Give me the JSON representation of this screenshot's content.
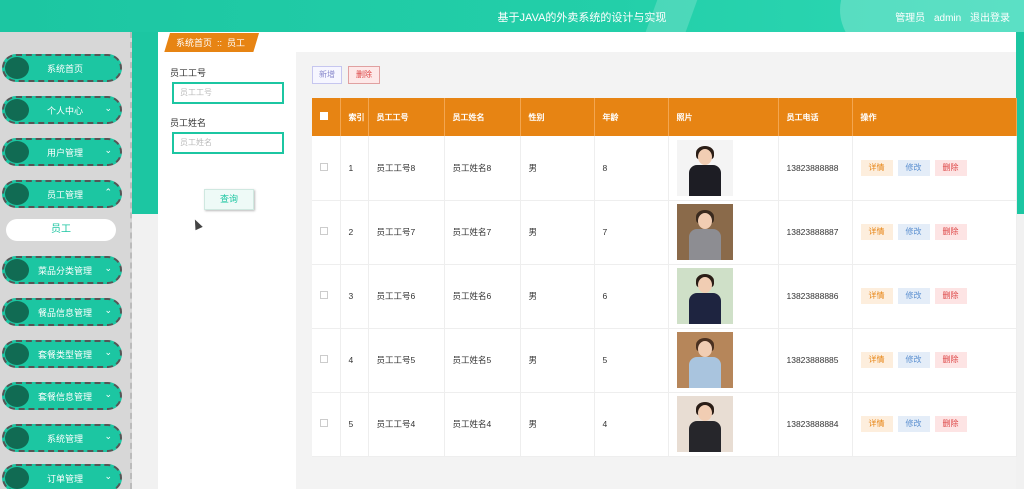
{
  "header": {
    "title": "基于JAVA的外卖系统的设计与实现",
    "role": "管理员",
    "username": "admin",
    "logout": "退出登录"
  },
  "sidebar": {
    "items": [
      {
        "label": "系统首页"
      },
      {
        "label": "个人中心"
      },
      {
        "label": "用户管理"
      },
      {
        "label": "员工管理"
      },
      {
        "label": "菜品分类管理"
      },
      {
        "label": "餐品信息管理"
      },
      {
        "label": "套餐类型管理"
      },
      {
        "label": "套餐信息管理"
      },
      {
        "label": "系统管理"
      },
      {
        "label": "订单管理"
      }
    ],
    "submenu_active": "员工"
  },
  "breadcrumb": {
    "home": "系统首页",
    "separator": "::",
    "current": "员工"
  },
  "search": {
    "emp_no_label": "员工工号",
    "emp_no_placeholder": "员工工号",
    "emp_name_label": "员工姓名",
    "emp_name_placeholder": "员工姓名",
    "query_button": "查询"
  },
  "toolbar": {
    "new_label": "新增",
    "delete_label": "删除"
  },
  "table": {
    "columns": [
      "索引",
      "员工工号",
      "员工姓名",
      "性别",
      "年龄",
      "照片",
      "员工电话",
      "操作"
    ],
    "actions": {
      "detail": "详情",
      "edit": "修改",
      "delete": "删除"
    },
    "rows": [
      {
        "index": "1",
        "emp_no": "员工工号8",
        "name": "员工姓名8",
        "gender": "男",
        "age": "8",
        "phone": "13823888888"
      },
      {
        "index": "2",
        "emp_no": "员工工号7",
        "name": "员工姓名7",
        "gender": "男",
        "age": "7",
        "phone": "13823888887"
      },
      {
        "index": "3",
        "emp_no": "员工工号6",
        "name": "员工姓名6",
        "gender": "男",
        "age": "6",
        "phone": "13823888886"
      },
      {
        "index": "4",
        "emp_no": "员工工号5",
        "name": "员工姓名5",
        "gender": "男",
        "age": "5",
        "phone": "13823888885"
      },
      {
        "index": "5",
        "emp_no": "员工工号4",
        "name": "员工姓名4",
        "gender": "男",
        "age": "4",
        "phone": "13823888884"
      }
    ]
  },
  "colors": {
    "primary": "#1cc6a2",
    "header_orange": "#e78413",
    "sidebar_dot": "#116b53"
  }
}
